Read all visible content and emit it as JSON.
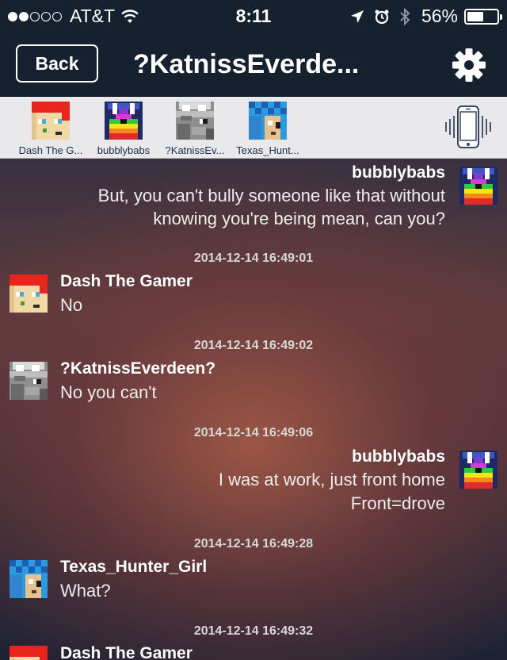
{
  "status_bar": {
    "carrier": "AT&T",
    "signal_dots_filled": 2,
    "signal_dots_total": 5,
    "time": "8:11",
    "battery_percent": "56%",
    "battery_level": 0.56
  },
  "nav": {
    "back_label": "Back",
    "title": "?KatnissEverde..."
  },
  "participants": [
    {
      "label": "Dash The G...",
      "avatar": "dash-avatar"
    },
    {
      "label": "bubblybabs",
      "avatar": "bubbly-avatar"
    },
    {
      "label": "?KatnissEv...",
      "avatar": "katniss-avatar"
    },
    {
      "label": "Texas_Hunt...",
      "avatar": "texas-avatar"
    }
  ],
  "messages": [
    {
      "sender": "bubblybabs",
      "lines": [
        "But, you can't bully someone like that without",
        "knowing you're being mean, can you?"
      ],
      "align": "right"
    },
    {
      "timestamp": "2014-12-14 16:49:01",
      "sender": "Dash The Gamer",
      "lines": [
        "No"
      ],
      "align": "left"
    },
    {
      "timestamp": "2014-12-14 16:49:02",
      "sender": "?KatnissEverdeen?",
      "lines": [
        "No you can't"
      ],
      "align": "left"
    },
    {
      "timestamp": "2014-12-14 16:49:06",
      "sender": "bubblybabs",
      "lines": [
        "I was at work, just front home",
        "Front=drove"
      ],
      "align": "right"
    },
    {
      "timestamp": "2014-12-14 16:49:28",
      "sender": "Texas_Hunter_Girl",
      "lines": [
        "What?"
      ],
      "align": "left"
    },
    {
      "timestamp": "2014-12-14 16:49:32",
      "sender": "Dash The Gamer",
      "lines": [],
      "align": "left"
    }
  ],
  "colors": {
    "navbar": "#162130",
    "participants_bg": "#e9e9ec",
    "participant_text": "#1b2b47"
  }
}
